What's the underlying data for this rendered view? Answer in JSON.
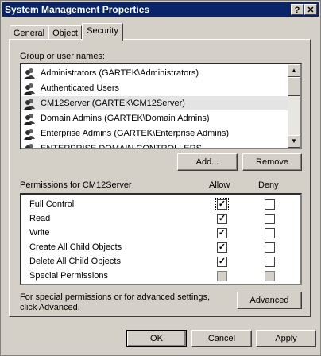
{
  "window": {
    "title": "System Management Properties",
    "help_label": "?",
    "close_label": "✕"
  },
  "tabs": [
    {
      "label": "General"
    },
    {
      "label": "Object"
    },
    {
      "label": "Security"
    }
  ],
  "groups": {
    "label": "Group or user names:",
    "items": [
      {
        "label": "Administrators (GARTEK\\Administrators)"
      },
      {
        "label": "Authenticated Users"
      },
      {
        "label": "CM12Server (GARTEK\\CM12Server)"
      },
      {
        "label": "Domain Admins (GARTEK\\Domain Admins)"
      },
      {
        "label": "Enterprise Admins (GARTEK\\Enterprise Admins)"
      },
      {
        "label": "ENTERPRISE DOMAIN CONTROLLERS"
      }
    ],
    "add_label": "Add...",
    "remove_label": "Remove"
  },
  "permissions": {
    "title": "Permissions for CM12Server",
    "allow_label": "Allow",
    "deny_label": "Deny",
    "rows": [
      {
        "label": "Full Control",
        "allow": "✓",
        "deny": ""
      },
      {
        "label": "Read",
        "allow": "✓",
        "deny": ""
      },
      {
        "label": "Write",
        "allow": "✓",
        "deny": ""
      },
      {
        "label": "Create All Child Objects",
        "allow": "✓",
        "deny": ""
      },
      {
        "label": "Delete All Child Objects",
        "allow": "✓",
        "deny": ""
      },
      {
        "label": "Special Permissions",
        "allow": "",
        "deny": ""
      }
    ]
  },
  "advanced": {
    "note_line1": "For special permissions or for advanced settings,",
    "note_line2": "click Advanced.",
    "button_label": "Advanced"
  },
  "footer": {
    "ok_label": "OK",
    "cancel_label": "Cancel",
    "apply_label": "Apply"
  }
}
